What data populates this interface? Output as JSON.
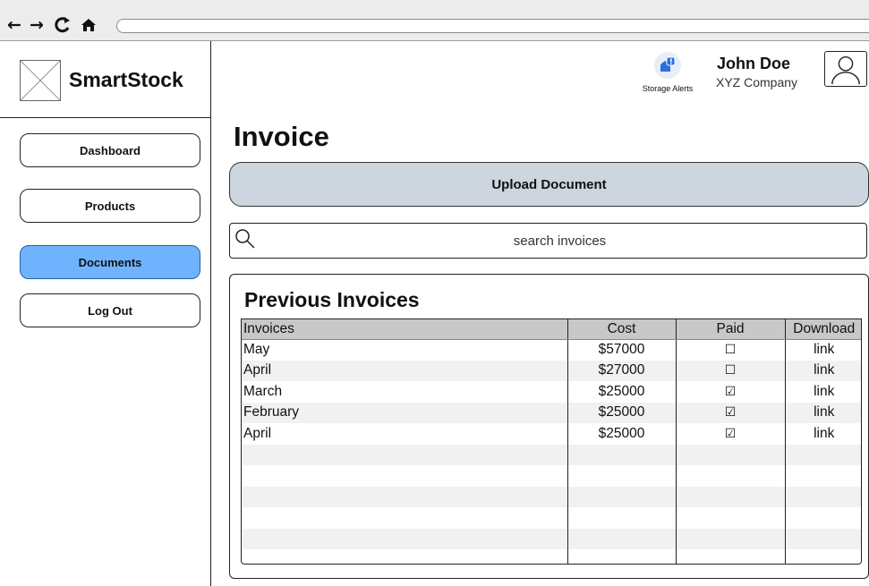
{
  "browser": {
    "back_icon": "←",
    "forward_icon": "→",
    "reload_icon": "C",
    "home_icon": "⌂"
  },
  "sidebar": {
    "brand": "SmartStock",
    "items": [
      {
        "label": "Dashboard",
        "active": false
      },
      {
        "label": "Products",
        "active": false
      },
      {
        "label": "Documents",
        "active": true
      },
      {
        "label": "Log Out",
        "active": false
      }
    ]
  },
  "header": {
    "alerts_label": "Storage Alerts",
    "user_name": "John Doe",
    "company": "XYZ Company"
  },
  "main": {
    "title": "Invoice",
    "upload_label": "Upload Document",
    "search_placeholder": "search invoices",
    "panel_title": "Previous Invoices",
    "columns": [
      "Invoices",
      "Cost",
      "Paid",
      "Download"
    ],
    "rows": [
      {
        "name": "May",
        "cost": "$57000",
        "paid": false,
        "download": "link"
      },
      {
        "name": "April",
        "cost": "$27000",
        "paid": false,
        "download": "link"
      },
      {
        "name": "March",
        "cost": "$25000",
        "paid": true,
        "download": "link"
      },
      {
        "name": "February",
        "cost": "$25000",
        "paid": true,
        "download": "link"
      },
      {
        "name": "April",
        "cost": "$25000",
        "paid": true,
        "download": "link"
      }
    ]
  },
  "colors": {
    "active_nav": "#6fb3ff",
    "upload_button": "#cdd5de",
    "table_header": "#c8c8c8",
    "alert_blue": "#2c6fe0"
  }
}
